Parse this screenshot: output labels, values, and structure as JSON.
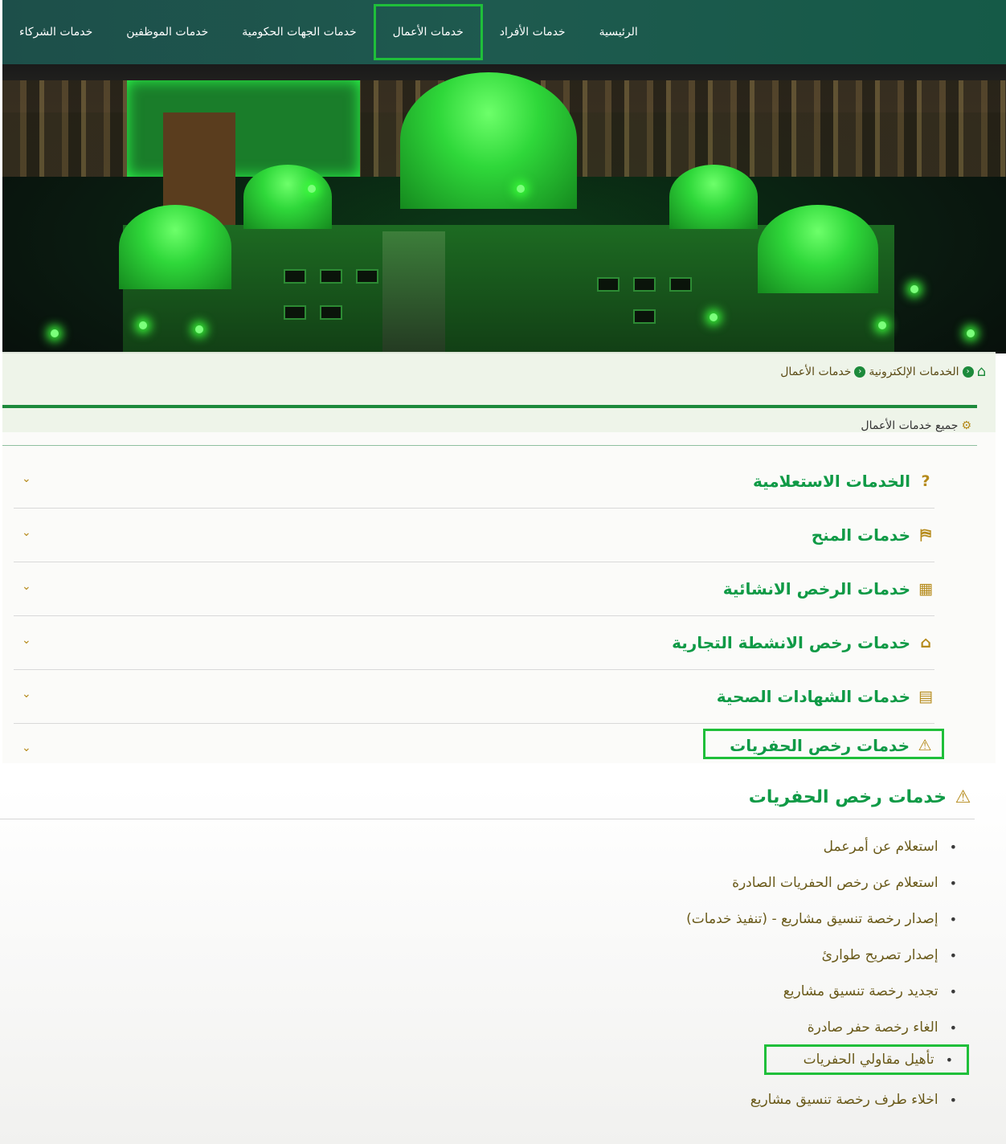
{
  "nav": {
    "items": [
      {
        "label": "الرئيسية"
      },
      {
        "label": "خدمات الأفراد"
      },
      {
        "label": "خدمات الأعمال"
      },
      {
        "label": "خدمات الجهات الحكومية"
      },
      {
        "label": "خدمات الموظفين"
      },
      {
        "label": "خدمات الشركاء"
      }
    ],
    "active_index": 2
  },
  "breadcrumb": {
    "home_icon": "home-icon",
    "items": [
      {
        "label": "الخدمات الإلكترونية"
      },
      {
        "label": "خدمات الأعمال"
      }
    ]
  },
  "all_services": {
    "icon": "cogs-icon",
    "label": "جميع خدمات الأعمال"
  },
  "accordion": [
    {
      "icon": "question-icon",
      "label": "الخدمات الاستعلامية"
    },
    {
      "icon": "map-icon",
      "label": "خدمات المنح"
    },
    {
      "icon": "building-icon",
      "label": "خدمات الرخص الانشائية"
    },
    {
      "icon": "store-icon",
      "label": "خدمات رخص الانشطة التجارية"
    },
    {
      "icon": "id-card-icon",
      "label": "خدمات الشهادات الصحية"
    },
    {
      "icon": "warning-icon",
      "label": "خدمات رخص الحفريات"
    }
  ],
  "section": {
    "icon": "warning-icon",
    "title": "خدمات رخص الحفريات",
    "items": [
      {
        "label": "استعلام عن أمرعمل"
      },
      {
        "label": "استعلام عن رخص الحفريات الصادرة"
      },
      {
        "label": "إصدار رخصة تنسيق مشاريع - (تنفيذ خدمات)"
      },
      {
        "label": "إصدار تصريح طوارئ"
      },
      {
        "label": "تجديد رخصة تنسيق مشاريع"
      },
      {
        "label": "الغاء رخصة حفر صادرة"
      },
      {
        "label": "تأهيل مقاولي الحفريات"
      },
      {
        "label": "اخلاء طرف رخصة تنسيق مشاريع"
      }
    ]
  },
  "colors": {
    "primary_green": "#0f9a46",
    "highlight_border": "#1fbf3a",
    "accent_gold": "#b58a1a",
    "nav_bg": "#1d4f4a"
  }
}
